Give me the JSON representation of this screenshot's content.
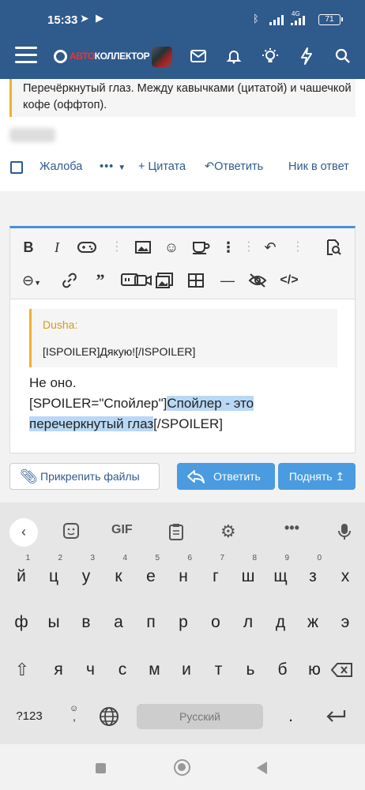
{
  "status_bar": {
    "time": "15:33",
    "network": "4G",
    "battery": "71"
  },
  "app_bar": {
    "logo_text_red": "АВТО",
    "logo_text_white": "КОЛЛЕКТОР"
  },
  "post": {
    "quote_text": "Перечёркнутый глаз. Между кавычками (цитатой) и чашечкой кофе (оффтоп).",
    "actions": {
      "report": "Жалоба",
      "more": "•••",
      "quote": "+ Цитата",
      "reply": "Ответить",
      "reply_to": "Ник в ответ"
    }
  },
  "editor": {
    "quote_author": "Dusha:",
    "quote_body": "[ISPOILER]Дякую![/ISPOILER]",
    "line1": "Не оно.",
    "line2_plain": "[SPOILER=\"Спойлер\"]",
    "line2_hl": "Спойлер - это",
    "line3_hl": "перечеркнутый глаз",
    "line3_plain": "[/SPOILER]"
  },
  "buttons": {
    "attach": "Прикрепить файлы",
    "reply": "Ответить",
    "bump": "Поднять ↥"
  },
  "keyboard": {
    "gif": "GIF",
    "row1": [
      {
        "k": "й",
        "n": "1"
      },
      {
        "k": "ц",
        "n": "2"
      },
      {
        "k": "у",
        "n": "3"
      },
      {
        "k": "к",
        "n": "4"
      },
      {
        "k": "е",
        "n": "5"
      },
      {
        "k": "н",
        "n": "6"
      },
      {
        "k": "г",
        "n": "7"
      },
      {
        "k": "ш",
        "n": "8"
      },
      {
        "k": "щ",
        "n": "9"
      },
      {
        "k": "з",
        "n": "0"
      },
      {
        "k": "х",
        "n": ""
      }
    ],
    "row2": [
      "ф",
      "ы",
      "в",
      "а",
      "п",
      "р",
      "о",
      "л",
      "д",
      "ж",
      "э"
    ],
    "row3": [
      "я",
      "ч",
      "с",
      "м",
      "и",
      "т",
      "ь",
      "б",
      "ю"
    ],
    "numbers_key": "?123",
    "space_label": "Русский",
    "period": "."
  }
}
